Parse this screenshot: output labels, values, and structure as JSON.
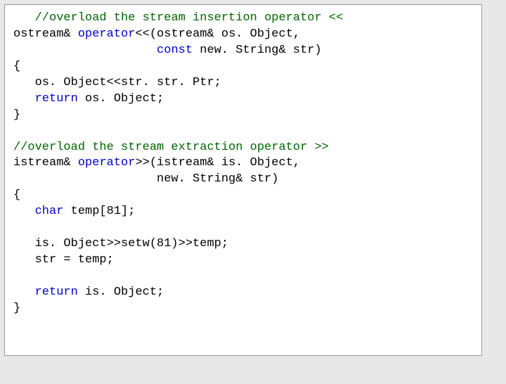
{
  "code": {
    "l01a": "   ",
    "l01b": "//overload the stream insertion operator <<",
    "l02a": "ostream& ",
    "l02b": "operator",
    "l02c": "<<(ostream& os. Object,",
    "l03a": "                    ",
    "l03b": "const",
    "l03c": " new. String& str)",
    "l04": "{",
    "l05": "   os. Object<<str. str. Ptr;",
    "l06a": "   ",
    "l06b": "return",
    "l06c": " os. Object;",
    "l07": "}",
    "l08": "",
    "l09": "//overload the stream extraction operator >>",
    "l10a": "istream& ",
    "l10b": "operator",
    "l10c": ">>(istream& is. Object,",
    "l11": "                    new. String& str)",
    "l12": "{",
    "l13a": "   ",
    "l13b": "char",
    "l13c": " temp[81];",
    "l14": "   is. Object>>setw(81)>>temp;",
    "l15": "   str = temp;",
    "l16a": "   ",
    "l16b": "return",
    "l16c": " is. Object;",
    "l17": "}"
  }
}
